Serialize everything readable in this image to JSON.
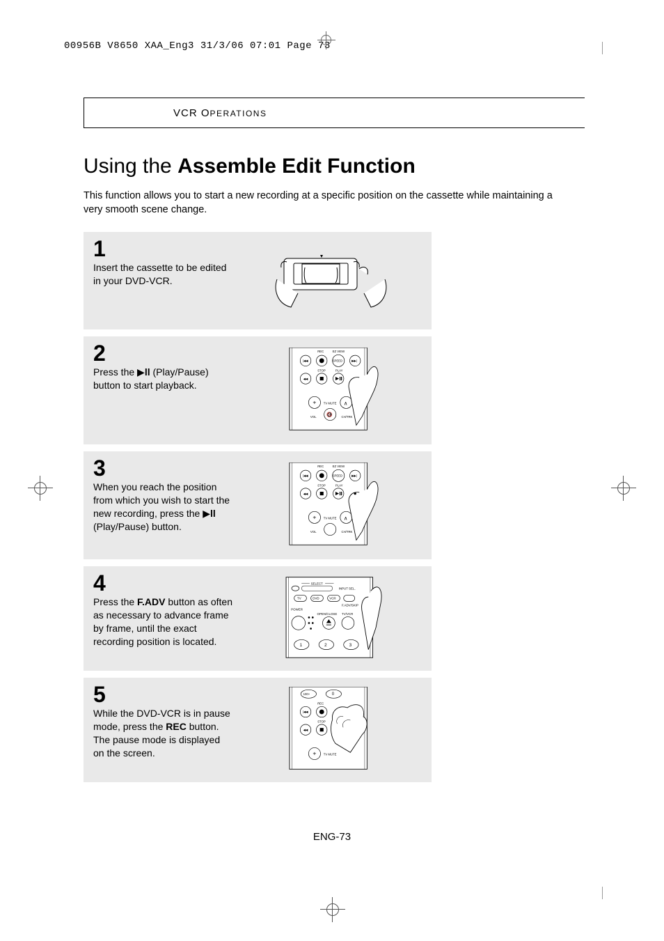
{
  "header": {
    "print_info": "00956B V8650 XAA_Eng3  31/3/06  07:01  Page 73"
  },
  "section_label": "VCR OPERATIONS",
  "title_prefix": "Using the ",
  "title_main": "Assemble Edit Function",
  "intro": "This function allows you to start a new recording at a specific position on the cassette while maintaining a very smooth scene change.",
  "steps": [
    {
      "num": "1",
      "text": "Insert the cassette to be edited in your DVD-VCR."
    },
    {
      "num": "2",
      "text_before": "Press the ",
      "text_after": " (Play/Pause) button to start playback."
    },
    {
      "num": "3",
      "text_before": "When you reach the position from which you wish to start the new recording, press the ",
      "text_after": " (Play/Pause) button."
    },
    {
      "num": "4",
      "text_before": "Press the ",
      "bold": "F.ADV",
      "text_after": " button as often as necessary to advance frame by frame, until the exact recording position is located."
    },
    {
      "num": "5",
      "text_before": "While the DVD-VCR is in pause mode, press the ",
      "bold": "REC",
      "text_after": " button. The pause mode is displayed on the screen."
    }
  ],
  "page_number": "ENG-73",
  "remote_labels": {
    "rec": "REC",
    "ez_view": "EZ VIEW",
    "stop": "STOP",
    "play": "PLAY",
    "speed": "SPEED",
    "tv_mute": "TV MUTE",
    "vol": "VOL",
    "ch_trk": "CH/TRK",
    "select": "SELECT",
    "tv": "TV",
    "dvd": "DVD",
    "vcr": "VCR",
    "input_sel": "INPUT SEL.",
    "fadv_skip": "F.ADV/SKIP",
    "power": "POWER",
    "open_close": "OPEN/CLOSE",
    "tv_vcr": "TV/VCR",
    "n1": "1",
    "n2": "2",
    "n3": "3",
    "n0": "0",
    "n100": "100+"
  }
}
